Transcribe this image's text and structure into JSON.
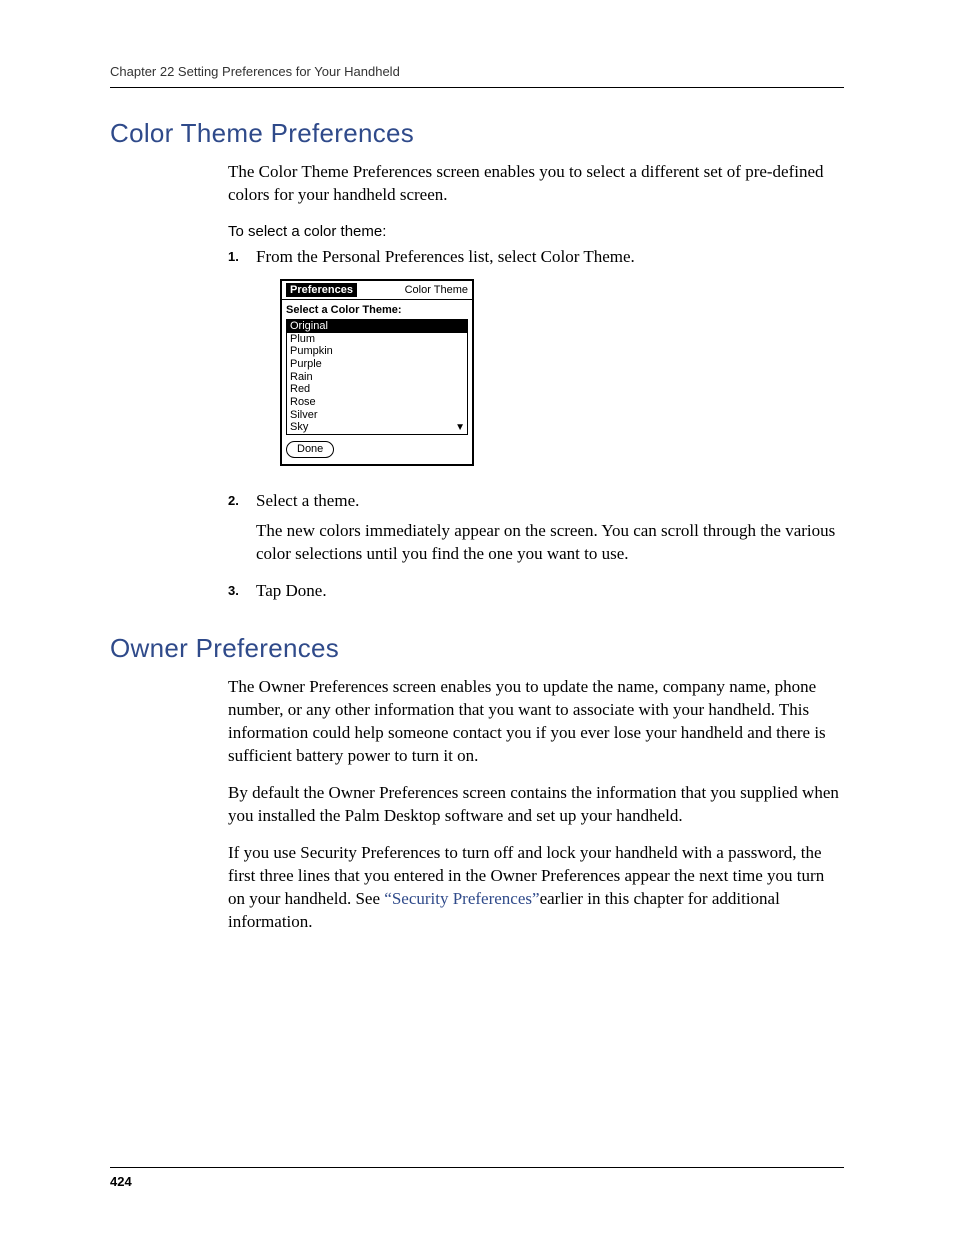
{
  "header": {
    "chapter_line": "Chapter 22   Setting Preferences for Your Handheld"
  },
  "section1": {
    "title": "Color Theme Preferences",
    "intro": "The Color Theme Preferences screen enables you to select a different set of pre-defined colors for your handheld screen.",
    "howto_heading": "To select a color theme:",
    "steps": {
      "s1": "From the Personal Preferences list, select Color Theme.",
      "s2": "Select a theme.",
      "s2_extra": "The new colors immediately appear on the screen. You can scroll through the various color selections until you find the one you want to use.",
      "s3": "Tap Done."
    }
  },
  "palm": {
    "title": "Preferences",
    "menu_label": "Color Theme",
    "list_label": "Select a Color Theme:",
    "items": [
      "Original",
      "Plum",
      "Pumpkin",
      "Purple",
      "Rain",
      "Red",
      "Rose",
      "Silver",
      "Sky"
    ],
    "selected_index": 0,
    "done_label": "Done"
  },
  "section2": {
    "title": "Owner Preferences",
    "p1": "The Owner Preferences screen enables you to update the name, company name, phone number, or any other information that you want to associate with your handheld. This information could help someone contact you if you ever lose your handheld and there is sufficient battery power to turn it on.",
    "p2": "By default the Owner Preferences screen contains the information that you supplied when you installed the Palm Desktop software and set up your handheld.",
    "p3_before": "If you use Security Preferences to turn off and lock your handheld with a password, the first three lines that you entered in the Owner Preferences appear the next time you turn on your handheld. See ",
    "link_text": "“Security Preferences”",
    "p3_after": "earlier in this chapter for additional information."
  },
  "footer": {
    "page_number": "424"
  }
}
